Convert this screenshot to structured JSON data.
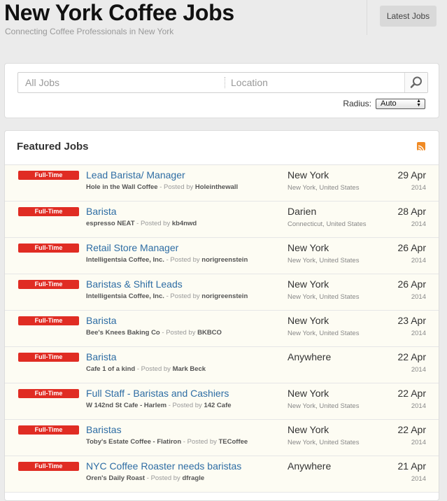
{
  "header": {
    "title": "New York Coffee Jobs",
    "tagline": "Connecting Coffee Professionals in New York",
    "latest_jobs_label": "Latest Jobs"
  },
  "search": {
    "keyword_placeholder": "All Jobs",
    "location_placeholder": "Location",
    "search_icon": "magnifier-icon",
    "radius_label": "Radius:",
    "radius_value": "Auto"
  },
  "featured": {
    "title": "Featured Jobs",
    "rss_icon": "rss-icon",
    "colors": {
      "badge": "#e02c23",
      "link": "#2e6da4",
      "row_bg": "#fdfcf3",
      "rss": "#f08a24"
    },
    "jobs": [
      {
        "type": "Full-Time",
        "title": "Lead Barista/ Manager",
        "company": "Hole in the Wall Coffee",
        "posted_by_label": "Posted by",
        "poster": "Holeinthewall",
        "city": "New York",
        "region": "New York, United States",
        "date": "29 Apr",
        "year": "2014"
      },
      {
        "type": "Full-Time",
        "title": "Barista",
        "company": "espresso NEAT",
        "posted_by_label": "Posted by",
        "poster": "kb4nwd",
        "city": "Darien",
        "region": "Connecticut, United States",
        "date": "28 Apr",
        "year": "2014"
      },
      {
        "type": "Full-Time",
        "title": "Retail Store Manager",
        "company": "Intelligentsia Coffee, Inc.",
        "posted_by_label": "Posted by",
        "poster": "norigreenstein",
        "city": "New York",
        "region": "New York, United States",
        "date": "26 Apr",
        "year": "2014"
      },
      {
        "type": "Full-Time",
        "title": "Baristas & Shift Leads",
        "company": "Intelligentsia Coffee, Inc.",
        "posted_by_label": "Posted by",
        "poster": "norigreenstein",
        "city": "New York",
        "region": "New York, United States",
        "date": "26 Apr",
        "year": "2014"
      },
      {
        "type": "Full-Time",
        "title": "Barista",
        "company": "Bee's Knees Baking Co",
        "posted_by_label": "Posted by",
        "poster": "BKBCO",
        "city": "New York",
        "region": "New York, United States",
        "date": "23 Apr",
        "year": "2014"
      },
      {
        "type": "Full-Time",
        "title": "Barista",
        "company": "Cafe 1 of a kind",
        "posted_by_label": "Posted by",
        "poster": "Mark Beck",
        "city": "Anywhere",
        "region": "",
        "date": "22 Apr",
        "year": "2014"
      },
      {
        "type": "Full-Time",
        "title": "Full Staff - Baristas and Cashiers",
        "company": "W 142nd St Cafe - Harlem",
        "posted_by_label": "Posted by",
        "poster": "142 Cafe",
        "city": "New York",
        "region": "New York, United States",
        "date": "22 Apr",
        "year": "2014"
      },
      {
        "type": "Full-Time",
        "title": "Baristas",
        "company": "Toby's Estate Coffee - Flatiron",
        "posted_by_label": "Posted by",
        "poster": "TECoffee",
        "city": "New York",
        "region": "New York, United States",
        "date": "22 Apr",
        "year": "2014"
      },
      {
        "type": "Full-Time",
        "title": "NYC Coffee Roaster needs baristas",
        "company": "Oren's Daily Roast",
        "posted_by_label": "Posted by",
        "poster": "dfragle",
        "city": "Anywhere",
        "region": "",
        "date": "21 Apr",
        "year": "2014"
      }
    ]
  }
}
